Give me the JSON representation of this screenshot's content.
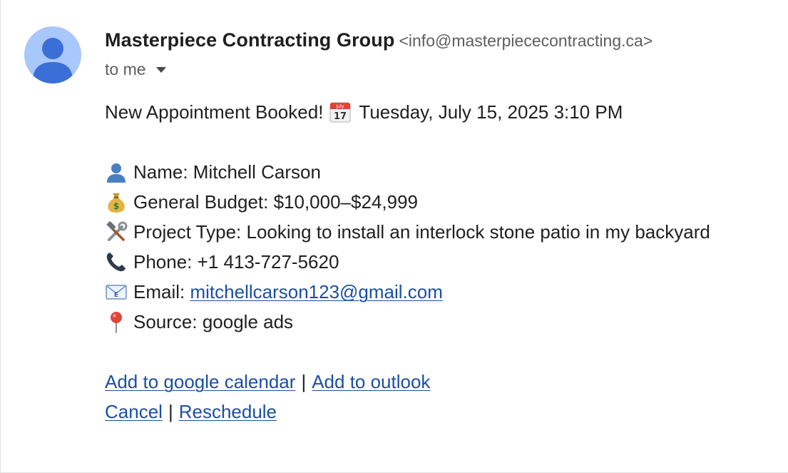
{
  "sender": {
    "name": "Masterpiece Contracting Group",
    "email": "<info@masterpiececontracting.ca>"
  },
  "recipient": {
    "label": "to me"
  },
  "message": {
    "headline": "New Appointment Booked!",
    "calendar_icon_text": "July",
    "calendar_icon_day": "17",
    "datetime": "Tuesday, July 15, 2025 3:10 PM",
    "name_label": "Name: Mitchell Carson",
    "budget_label": "General Budget: $10,000–$24,999",
    "project_label": "Project Type: Looking to install an interlock stone patio in my backyard",
    "phone_label": "Phone: +1 413-727-5620",
    "email_prefix": "Email:",
    "email_link": "mitchellcarson123@gmail.com",
    "source_label": "Source: google ads"
  },
  "actions": {
    "google_calendar": "Add to google calendar",
    "outlook": "Add to outlook",
    "cancel": "Cancel",
    "reschedule": "Reschedule",
    "separator": "|"
  },
  "icons": {
    "avatar": "person-avatar-icon",
    "calendar": "calendar-icon",
    "person": "bust-in-silhouette-icon",
    "money": "money-bag-icon",
    "tools": "hammer-and-wrench-icon",
    "phone": "telephone-receiver-icon",
    "email": "e-mail-icon",
    "pin": "round-pushpin-icon",
    "caret": "caret-down-icon"
  },
  "colors": {
    "link": "#1a4fa3",
    "avatar_bg": "#a8c7fa",
    "avatar_fg": "#3b6fd8",
    "muted_text": "#5e5e5e"
  }
}
